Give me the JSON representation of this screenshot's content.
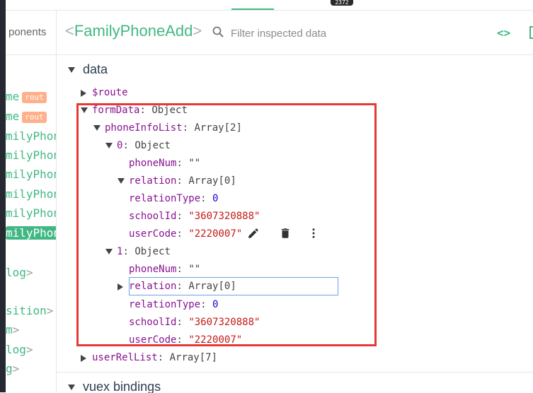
{
  "top": {
    "badge": "2372"
  },
  "left_panel": {
    "header_label": "ponents",
    "items": [
      {
        "text": "me",
        "bracket": "",
        "badge": "rout"
      },
      {
        "text": "me",
        "bracket": "",
        "badge": "rout"
      },
      {
        "text": "milyPhon",
        "bracket": "",
        "badge": ""
      },
      {
        "text": "milyPhon",
        "bracket": "",
        "badge": ""
      },
      {
        "text": "milyPhon",
        "bracket": "",
        "badge": ""
      },
      {
        "text": "milyPhon",
        "bracket": "",
        "badge": ""
      },
      {
        "text": "milyPhon",
        "bracket": "",
        "badge": ""
      },
      {
        "text": "milyPhon",
        "bracket": "",
        "badge": ""
      },
      {
        "text": "log",
        "bracket": ">",
        "badge": ""
      },
      {
        "text": "sition",
        "bracket": ">",
        "badge": ""
      },
      {
        "text": "m",
        "bracket": ">",
        "badge": ""
      },
      {
        "text": "log",
        "bracket": ">",
        "badge": ""
      },
      {
        "text": "g",
        "bracket": ">",
        "badge": ""
      }
    ]
  },
  "header": {
    "open_bracket": "<",
    "component_name": "FamilyPhoneAdd",
    "close_bracket": ">",
    "search_placeholder": "Filter inspected data",
    "code_icon": "<>"
  },
  "sections": {
    "data_title": "data",
    "vuex_title": "vuex bindings"
  },
  "tree": {
    "route_key": "$route",
    "formData_key": "formData",
    "formData_val": "Object",
    "phoneInfoList_key": "phoneInfoList",
    "phoneInfoList_val": "Array[2]",
    "item0_key": "0",
    "item0_val": "Object",
    "item0_phoneNum_key": "phoneNum",
    "item0_phoneNum_val": "\"\"",
    "item0_relation_key": "relation",
    "item0_relation_val": "Array[0]",
    "item0_relationType_key": "relationType",
    "item0_relationType_val": "0",
    "item0_schoolId_key": "schoolId",
    "item0_schoolId_val": "\"3607320888\"",
    "item0_userCode_key": "userCode",
    "item0_userCode_val": "\"2220007\"",
    "item1_key": "1",
    "item1_val": "Object",
    "item1_phoneNum_key": "phoneNum",
    "item1_phoneNum_val": "\"\"",
    "item1_relation_key": "relation",
    "item1_relation_val": "Array[0]",
    "item1_relationType_key": "relationType",
    "item1_relationType_val": "0",
    "item1_schoolId_key": "schoolId",
    "item1_schoolId_val": "\"3607320888\"",
    "item1_userCode_key": "userCode",
    "item1_userCode_val": "\"2220007\"",
    "userRelList_key": "userRelList",
    "userRelList_val": "Array[7]",
    "colon": ":"
  },
  "colors": {
    "accent": "#41b883",
    "highlight_box": "#e53935",
    "key": "#881391",
    "string": "#c41a16",
    "number": "#1c00cf"
  },
  "icons": [
    "search-icon",
    "code-icon",
    "edit-icon",
    "delete-icon",
    "more-vert-icon",
    "expand-arrow-icon",
    "collapse-arrow-icon"
  ]
}
